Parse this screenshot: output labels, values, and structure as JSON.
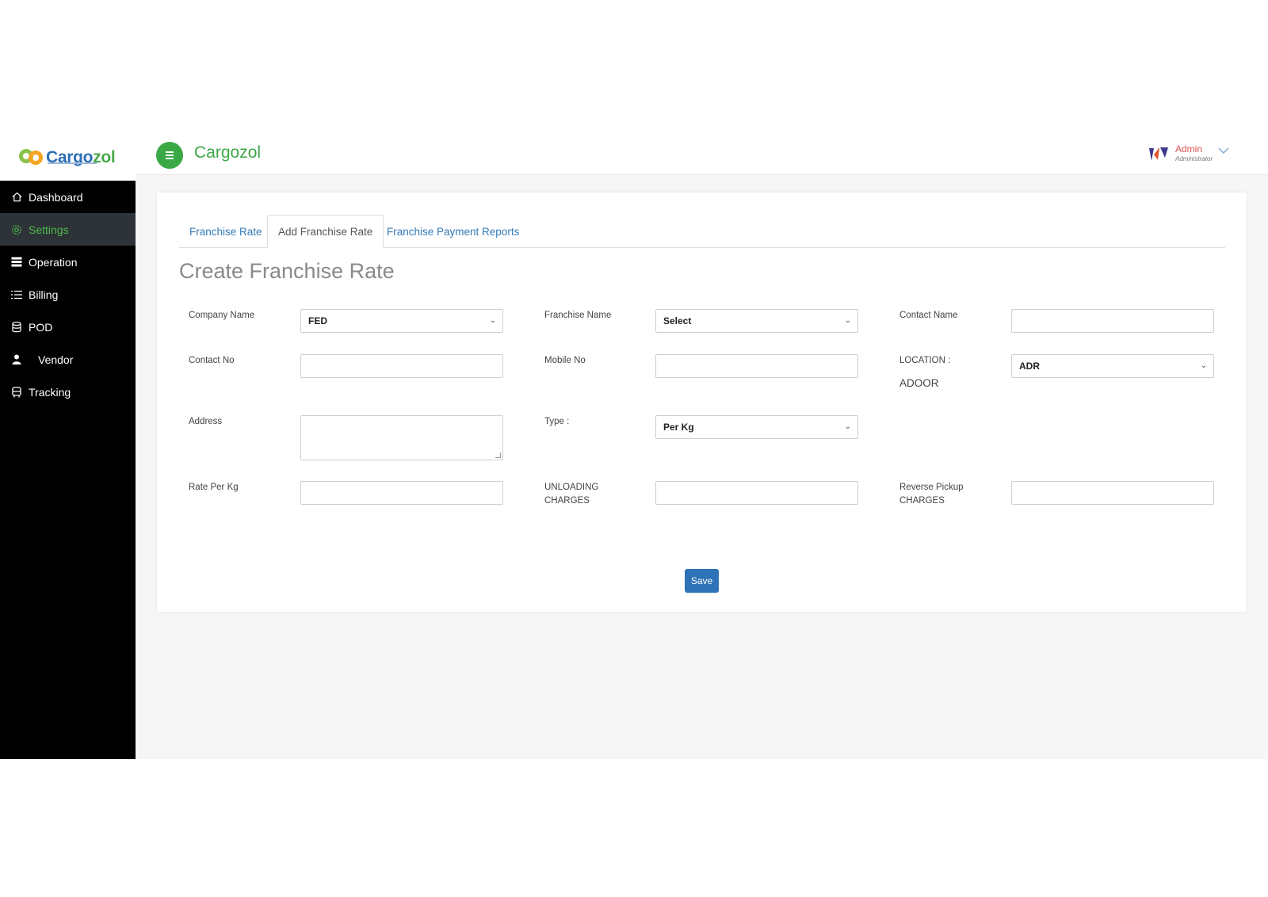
{
  "brand": {
    "logo_text_a": "Cargo",
    "logo_text_b": "zol",
    "app_title": "Cargozol"
  },
  "sidebar": {
    "items": [
      {
        "label": "Dashboard",
        "icon": "home-icon"
      },
      {
        "label": "Settings",
        "icon": "gear-icon"
      },
      {
        "label": "Operation",
        "icon": "server-icon"
      },
      {
        "label": "Billing",
        "icon": "list-icon"
      },
      {
        "label": "POD",
        "icon": "database-icon"
      },
      {
        "label": "Vendor",
        "icon": "user-icon"
      },
      {
        "label": "Tracking",
        "icon": "bus-icon"
      }
    ],
    "active": "Settings"
  },
  "user": {
    "name": "Admin",
    "role": "Administrator"
  },
  "tabs": [
    {
      "label": "Franchise Rate"
    },
    {
      "label": "Add Franchise Rate"
    },
    {
      "label": "Franchise Payment Reports"
    }
  ],
  "active_tab": "Add Franchise Rate",
  "page_title": "Create Franchise Rate",
  "form": {
    "company_name": {
      "label": "Company Name",
      "value": "FED"
    },
    "franchise_name": {
      "label": "Franchise Name",
      "value": "Select"
    },
    "contact_name": {
      "label": "Contact Name",
      "value": ""
    },
    "contact_no": {
      "label": "Contact No",
      "value": ""
    },
    "mobile_no": {
      "label": "Mobile No",
      "value": ""
    },
    "location": {
      "label": "LOCATION :",
      "value": "ADR",
      "display": "ADOOR"
    },
    "address": {
      "label": "Address",
      "value": ""
    },
    "type": {
      "label": "Type :",
      "value": "Per Kg"
    },
    "rate_per_kg": {
      "label": "Rate Per Kg",
      "value": ""
    },
    "unloading_charges": {
      "label_1": "UNLOADING",
      "label_2": "CHARGES",
      "value": ""
    },
    "reverse_pickup_charges": {
      "label_1": "Reverse Pickup",
      "label_2": "CHARGES",
      "value": ""
    },
    "save_label": "Save"
  },
  "colors": {
    "accent_green": "#3aa845",
    "link_blue": "#337ab7",
    "save_blue": "#2e73b8",
    "sidebar_bg": "#000000",
    "sidebar_active_bg": "#2e3338"
  }
}
